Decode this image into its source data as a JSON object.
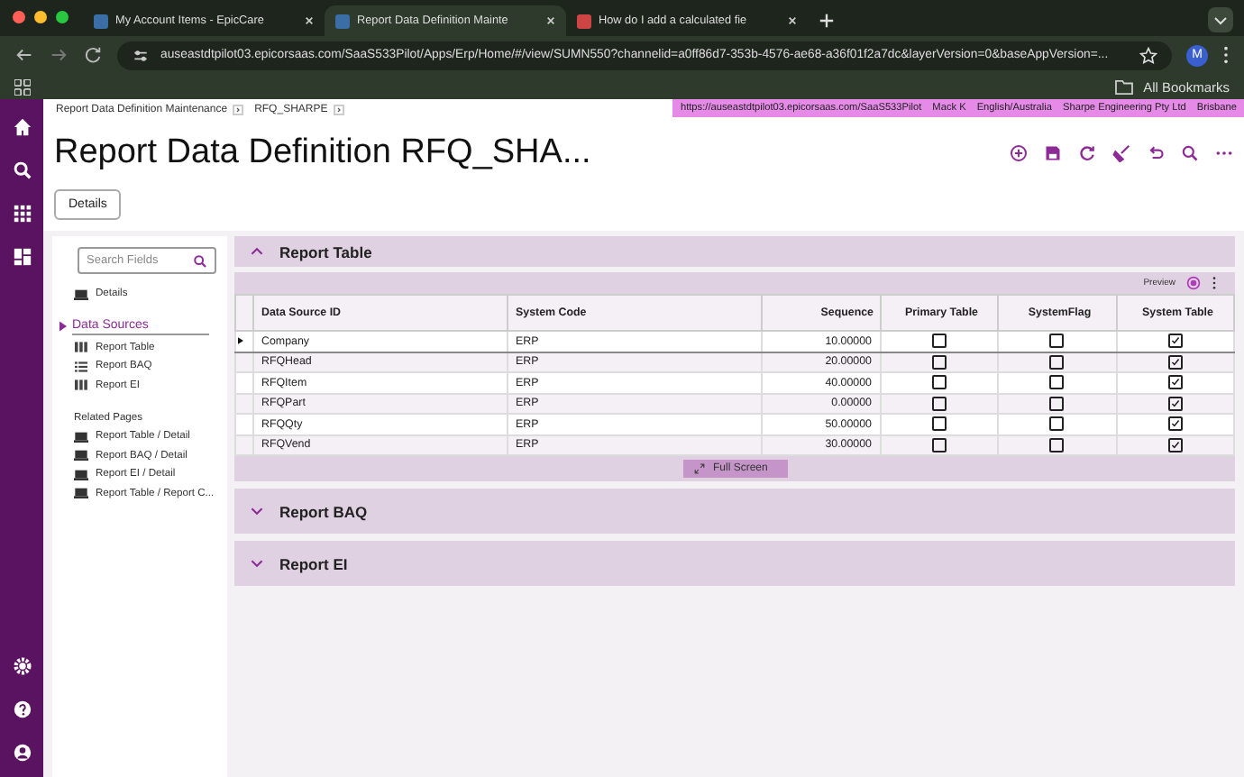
{
  "browser": {
    "tabs": [
      {
        "title": "My Account Items - EpicCare",
        "selected": false
      },
      {
        "title": "Report Data Definition Mainte",
        "selected": true
      },
      {
        "title": "How do I add a calculated fie",
        "selected": false
      }
    ],
    "url": "auseastdtpilot03.epicorsaas.com/SaaS533Pilot/Apps/Erp/Home/#/view/SUMN550?channelid=a0ff86d7-353b-4576-ae68-a36f01f2a7dc&layerVersion=0&baseAppVersion=...",
    "avatar": "M",
    "bookmarks": "All Bookmarks"
  },
  "breadcrumbs": [
    "Report Data Definition Maintenance",
    "RFQ_SHARPE"
  ],
  "info_bar": [
    "https://auseastdtpilot03.epicorsaas.com/SaaS533Pilot",
    "Mack K",
    "English/Australia",
    "Sharpe Engineering Pty Ltd",
    "Brisbane"
  ],
  "title": "Report Data Definition RFQ_SHA...",
  "details_button": "Details",
  "sidebar": {
    "search": {
      "placeholder": "Search Fields"
    },
    "top_item": "Details",
    "section": {
      "label": "Data Sources",
      "expanded": true
    },
    "items": [
      {
        "label": "Report Table",
        "kind": "grid"
      },
      {
        "label": "Report BAQ",
        "kind": "list"
      },
      {
        "label": "Report EI",
        "kind": "grid"
      }
    ],
    "related_heading": "Related Pages",
    "related": [
      "Report Table / Detail",
      "Report BAQ / Detail",
      "Report EI / Detail",
      "Report Table / Report C..."
    ]
  },
  "panels": [
    {
      "title": "Report Table",
      "expanded": true,
      "preview": "Preview",
      "table": {
        "columns": [
          "Data Source ID",
          "System Code",
          "Sequence",
          "Primary Table",
          "SystemFlag",
          "System Table"
        ],
        "rows": [
          {
            "id": "Company",
            "code": "ERP",
            "sequence": "10.00000",
            "primary": false,
            "flag": false,
            "system": true,
            "selected": true
          },
          {
            "id": "RFQHead",
            "code": "ERP",
            "sequence": "20.00000",
            "primary": false,
            "flag": false,
            "system": true,
            "selected": false
          },
          {
            "id": "RFQItem",
            "code": "ERP",
            "sequence": "40.00000",
            "primary": false,
            "flag": false,
            "system": true,
            "selected": false
          },
          {
            "id": "RFQPart",
            "code": "ERP",
            "sequence": "0.00000",
            "primary": false,
            "flag": false,
            "system": true,
            "selected": false
          },
          {
            "id": "RFQQty",
            "code": "ERP",
            "sequence": "50.00000",
            "primary": false,
            "flag": false,
            "system": true,
            "selected": false
          },
          {
            "id": "RFQVend",
            "code": "ERP",
            "sequence": "30.00000",
            "primary": false,
            "flag": false,
            "system": true,
            "selected": false
          }
        ]
      },
      "full_screen": "Full Screen"
    },
    {
      "title": "Report BAQ",
      "expanded": false
    },
    {
      "title": "Report EI",
      "expanded": false
    }
  ]
}
